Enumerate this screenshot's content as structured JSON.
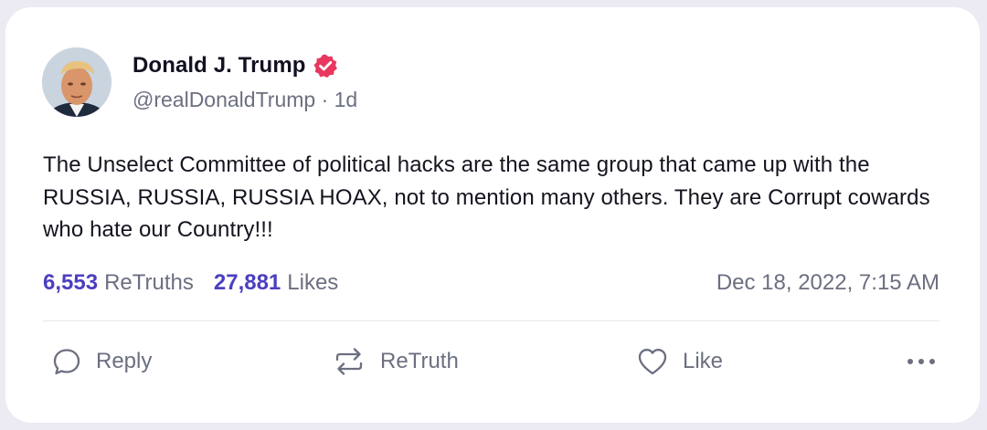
{
  "post": {
    "author": {
      "display_name": "Donald J. Trump",
      "handle": "@realDonaldTrump",
      "separator": " · ",
      "age": "1d",
      "verified": true,
      "verified_badge_icon": "verified-badge-icon",
      "verified_color": "#e9375f"
    },
    "text": "The Unselect Committee of political hacks are the same group that came up with the RUSSIA, RUSSIA, RUSSIA HOAX, not to mention many others. They are Corrupt cowards who hate our Country!!!",
    "stats": {
      "retruths_count": "6,553",
      "retruths_label": "ReTruths",
      "likes_count": "27,881",
      "likes_label": "Likes"
    },
    "timestamp": "Dec 18, 2022, 7:15 AM"
  },
  "actions": {
    "reply_label": "Reply",
    "retruth_label": "ReTruth",
    "like_label": "Like",
    "reply_icon": "speech-bubble-icon",
    "retruth_icon": "repost-arrows-icon",
    "like_icon": "heart-icon",
    "more_icon": "more-horizontal-icon"
  },
  "colors": {
    "accent": "#4b3fbf",
    "muted_text": "#6b6f80",
    "text": "#14141f",
    "page_background": "#ecebf3",
    "card_background": "#ffffff"
  }
}
